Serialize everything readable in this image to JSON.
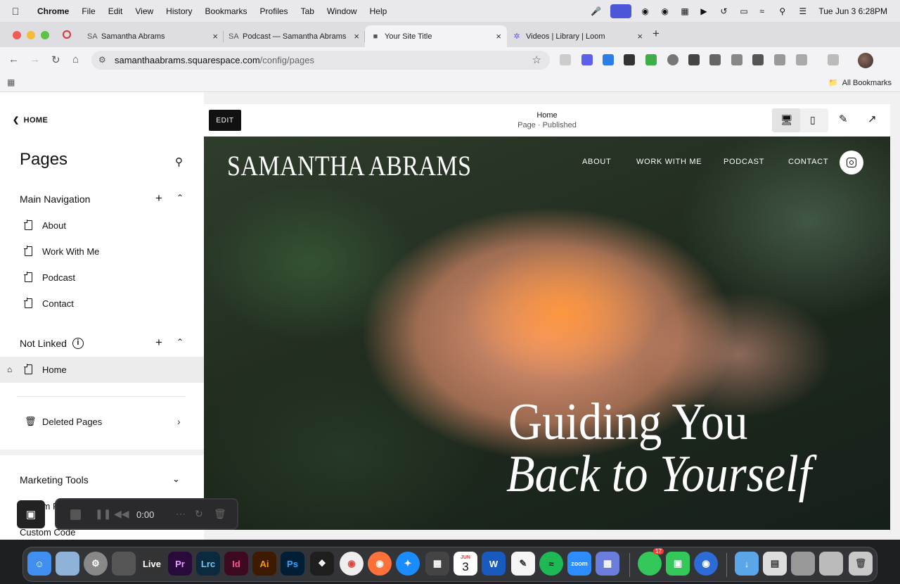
{
  "menubar": {
    "app": "Chrome",
    "items": [
      "File",
      "Edit",
      "View",
      "History",
      "Bookmarks",
      "Profiles",
      "Tab",
      "Window",
      "Help"
    ],
    "clock": "Tue Jun 3  6:28PM"
  },
  "tabs": [
    {
      "favicon": "SA",
      "title": "Samantha Abrams"
    },
    {
      "favicon": "SA",
      "title": "Podcast — Samantha Abrams"
    },
    {
      "favicon": "cube",
      "title": "Your Site Title"
    },
    {
      "favicon": "loom",
      "title": "Videos | Library | Loom"
    }
  ],
  "toolbar": {
    "url_host": "samanthaabrams.squarespace.com",
    "url_path": "/config/pages"
  },
  "bookmarks": {
    "all_label": "All Bookmarks"
  },
  "panel": {
    "back_label": "HOME",
    "title": "Pages",
    "main_nav_label": "Main Navigation",
    "main_nav_items": [
      "About",
      "Work With Me",
      "Podcast",
      "Contact"
    ],
    "not_linked_label": "Not Linked",
    "not_linked_items": [
      "Home"
    ],
    "deleted_label": "Deleted Pages",
    "marketing_label": "Marketing Tools",
    "marketing_sub1": "System P",
    "marketing_sub2": "Custom Code"
  },
  "preview": {
    "edit_label": "EDIT",
    "page_name": "Home",
    "page_status": "Page · Published",
    "site_logo": "SAMANTHA ABRAMS",
    "nav": [
      "ABOUT",
      "WORK WITH ME",
      "PODCAST",
      "CONTACT"
    ],
    "headline_1": "Guiding You",
    "headline_2": "Back to Yourself"
  },
  "recorder": {
    "time": "0:00"
  },
  "dock": {
    "apps": [
      "Finder",
      "Preview",
      "System Settings",
      "Screenshot",
      "Live",
      "Premiere Pro",
      "Lightroom Classic",
      "InDesign",
      "Illustrator",
      "Photoshop",
      "Figma",
      "Chrome",
      "Firefox",
      "Safari",
      "Calculator",
      "Calendar",
      "Word",
      "TextEdit",
      "Spotify",
      "Zoom",
      "Launchpad",
      "Messages",
      "FaceTime",
      "Screen Sharing",
      "Downloads",
      "Documents",
      "Recent",
      "Trash"
    ],
    "labels": {
      "live": "Live",
      "pr": "Pr",
      "lrc": "Lrc",
      "id": "Id",
      "ai": "Ai",
      "ps": "Ps",
      "w": "W",
      "zoom": "zoom",
      "calendar_month": "JUN",
      "calendar_day": "3",
      "messages_badge": "17"
    }
  },
  "colors": {
    "accent": "#4b57d8",
    "editbtn": "#111111",
    "page_bg": "#f1f1f1"
  }
}
